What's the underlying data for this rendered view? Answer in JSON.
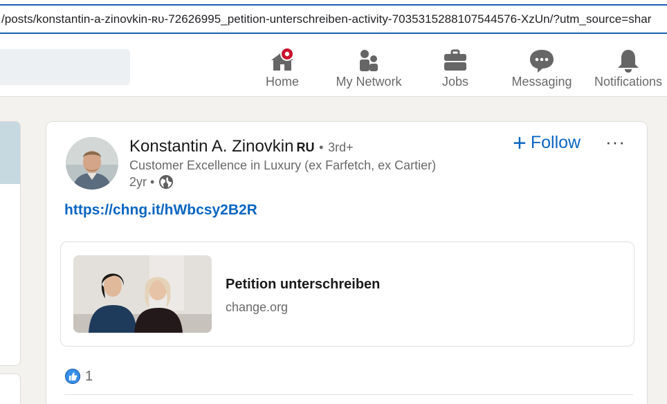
{
  "browser": {
    "url": "/posts/konstantin-a-zinovkin-ʀᴜ-72626995_petition-unterschreiben-activity-7035315288107544576-XzUn/?utm_source=shar"
  },
  "nav": {
    "items": [
      {
        "label": "Home",
        "icon": "home-icon",
        "badge": true
      },
      {
        "label": "My Network",
        "icon": "network-icon"
      },
      {
        "label": "Jobs",
        "icon": "briefcase-icon"
      },
      {
        "label": "Messaging",
        "icon": "message-icon"
      },
      {
        "label": "Notifications",
        "icon": "bell-icon"
      }
    ]
  },
  "post": {
    "author": {
      "name": "Konstantin A. Zinovkin",
      "flag": "RU",
      "separator": "•",
      "degree": "3rd+",
      "headline": "Customer Excellence in Luxury (ex Farfetch, ex Cartier)",
      "age": "2yr •"
    },
    "follow_label": "Follow",
    "follow_plus": "+",
    "more_label": "···",
    "link": "https://chng.it/hWbcsy2B2R",
    "preview": {
      "title": "Petition unterschreiben",
      "source": "change.org"
    },
    "reaction_count": "1"
  },
  "colors": {
    "accent": "#0a66c2",
    "badge": "#cb112d"
  }
}
